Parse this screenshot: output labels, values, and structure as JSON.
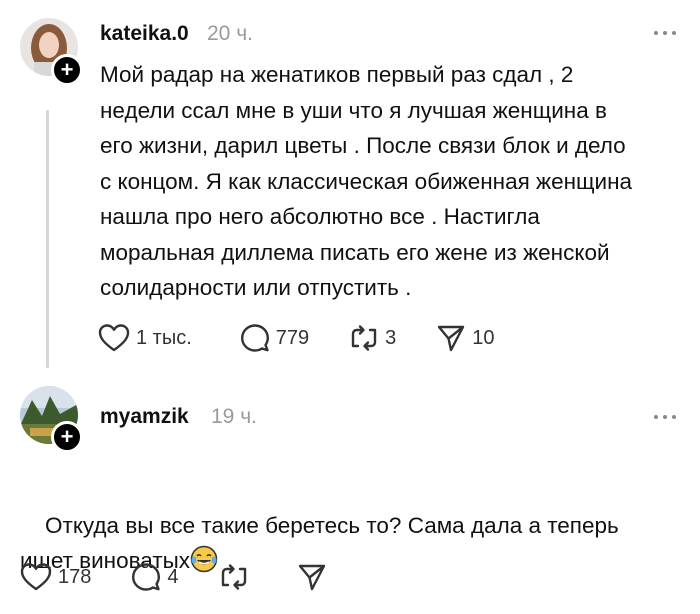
{
  "posts": [
    {
      "username": "kateika.0",
      "time": "20 ч.",
      "text": "Мой радар на женатиков первый раз сдал , 2\nнедели ссал мне в уши что я лучшая женщина в\nего жизни, дарил цветы . После связи блок и дело\nс концом. Я как классическая обиженная женщина\nнашла про него абсолютно все . Настигла\nморальная диллема писать его жене из женской\nсолидарности или отпустить .",
      "likes": "1 тыс.",
      "replies": "779",
      "reposts": "3",
      "shares": "10"
    },
    {
      "username": "myamzik",
      "time": "19 ч.",
      "text": "Откуда вы все такие беретесь то? Сама дала а теперь\nищет виноватых",
      "likes": "178",
      "replies": "4",
      "reposts": "",
      "shares": ""
    }
  ],
  "icons": {
    "avatar1": "avatar-photo-girl",
    "avatar2": "avatar-landscape",
    "follow": "plus-icon",
    "more": "more-dots-icon",
    "like": "heart-icon",
    "reply": "comment-icon",
    "repost": "repost-icon",
    "share": "send-icon",
    "emoji": "laughing-tears-emoji"
  }
}
